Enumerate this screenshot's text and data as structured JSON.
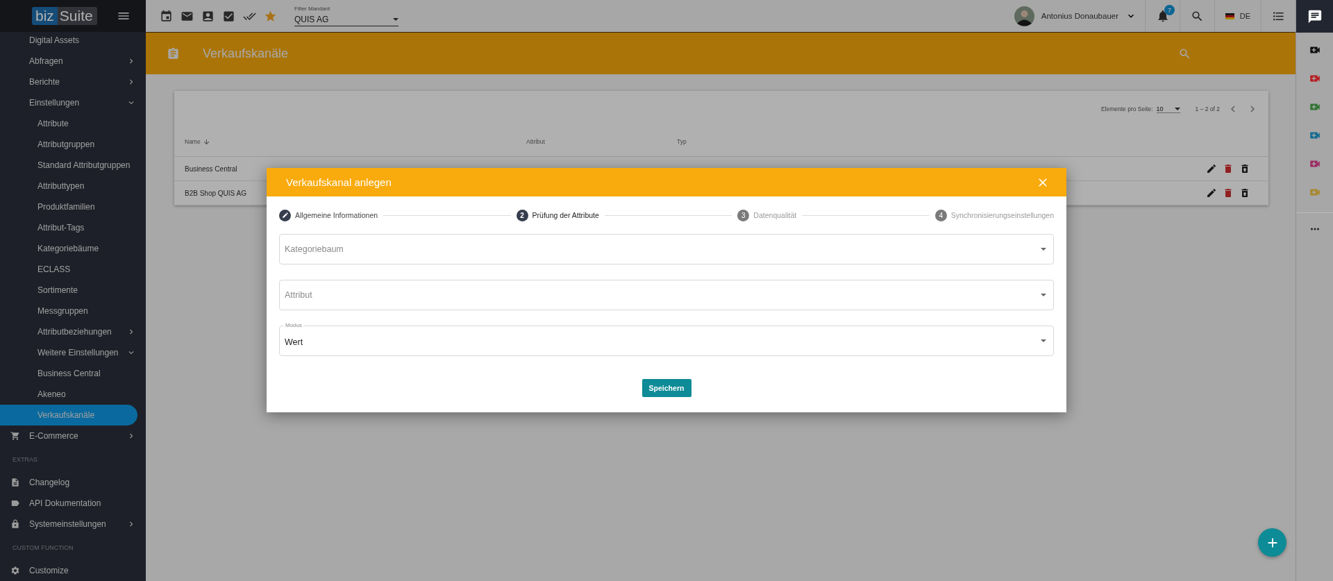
{
  "logo": {
    "part_1": "biz",
    "part_2": "Suite"
  },
  "toolbar": {
    "filter": {
      "label": "Filter Mandant",
      "value": "QUIS AG"
    }
  },
  "user": {
    "name": "Antonius Donaubauer"
  },
  "notifications": {
    "count": "7"
  },
  "language": {
    "code": "DE"
  },
  "sidebar": {
    "sections": [
      {
        "items": [
          {
            "label": "Digital Assets",
            "selected": false
          },
          {
            "label": "Abfragen",
            "selected": false,
            "expanded": false
          },
          {
            "label": "Berichte",
            "selected": false,
            "expanded": false
          },
          {
            "label": "Einstellungen",
            "selected": false,
            "expanded": true,
            "children": [
              {
                "label": "Attribute",
                "selected": false
              },
              {
                "label": "Attributgruppen",
                "selected": false
              },
              {
                "label": "Standard Attributgruppen",
                "selected": false
              },
              {
                "label": "Attributtypen",
                "selected": false
              },
              {
                "label": "Produktfamilien",
                "selected": false
              },
              {
                "label": "Attribut-Tags",
                "selected": false
              },
              {
                "label": "Kategoriebäume",
                "selected": false
              },
              {
                "label": "ECLASS",
                "selected": false
              },
              {
                "label": "Sortimente",
                "selected": false
              },
              {
                "label": "Messgruppen",
                "selected": false
              },
              {
                "label": "Attributbeziehungen",
                "selected": false,
                "expanded": false
              },
              {
                "label": "Weitere Einstellungen",
                "selected": false,
                "expanded": true,
                "children": [
                  {
                    "label": "Business Central",
                    "selected": false
                  },
                  {
                    "label": "Akeneo",
                    "selected": false
                  },
                  {
                    "label": "Verkaufskanäle",
                    "selected": true
                  }
                ]
              }
            ]
          },
          {
            "label": "E-Commerce",
            "selected": false,
            "expanded": false
          }
        ]
      },
      {
        "title": "EXTRAS",
        "items": [
          {
            "label": "Changelog",
            "selected": false
          },
          {
            "label": "API Dokumentation",
            "selected": false
          },
          {
            "label": "Systemeinstellungen",
            "selected": false,
            "expanded": false
          }
        ]
      },
      {
        "title": "CUSTOM FUNCTION",
        "items": [
          {
            "label": "Customize",
            "selected": false
          }
        ]
      }
    ]
  },
  "right_panel": {
    "video_buttons": [
      {
        "color": "#0e0e0e"
      },
      {
        "color": "#b81a1e"
      },
      {
        "color": "#2f7431"
      },
      {
        "color": "#126a91"
      },
      {
        "color": "#9c2a64"
      },
      {
        "color": "#a8862a"
      }
    ]
  },
  "page": {
    "title": "Verkaufskanäle"
  },
  "table": {
    "paginator": {
      "label": "Elemente pro Seite:",
      "page_size": "10",
      "range": "1 – 2 of 2"
    },
    "columns": [
      {
        "label": "Name",
        "sorted": true
      },
      {
        "label": "Attribut",
        "sorted": false
      },
      {
        "label": "Typ",
        "sorted": false
      }
    ],
    "rows": [
      {
        "name": "Business Central"
      },
      {
        "name": "B2B Shop QUIS AG"
      }
    ]
  },
  "dialog": {
    "title": "Verkaufskanal anlegen",
    "steps": [
      {
        "label": "Allgemeine Informationen",
        "completed": true,
        "selected": false
      },
      {
        "number": "2",
        "label": "Prüfung der Attribute",
        "completed": false,
        "selected": true
      },
      {
        "number": "3",
        "label": "Datenqualität",
        "completed": false,
        "selected": false
      },
      {
        "number": "4",
        "label": "Synchronisierungseinstellungen",
        "completed": false,
        "selected": false
      }
    ],
    "fields": [
      {
        "placeholder": "Kategoriebaum"
      },
      {
        "placeholder": "Attribut"
      },
      {
        "label": "Modus",
        "value": "Wert"
      }
    ],
    "save_button": "Speichern"
  }
}
